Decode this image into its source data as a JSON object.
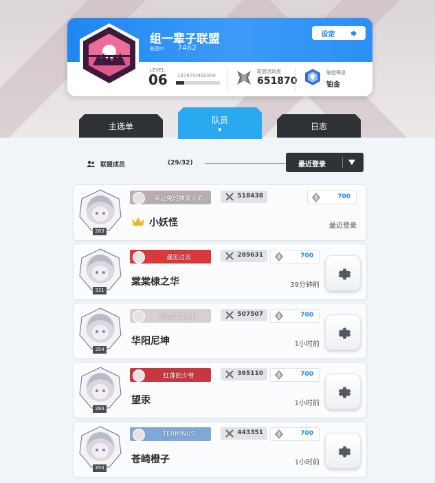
{
  "alliance": {
    "name": "组一辈子联盟",
    "id_label": "联盟ID",
    "id": "7462",
    "settings_label": "设定",
    "level_label": "LEVEL",
    "level": "06",
    "exp_text": "167870/900000",
    "exp_fraction": 0.19,
    "activity_label": "联盟活跃度",
    "activity": "651870",
    "rank_label": "联盟等级",
    "rank": "铂金"
  },
  "tabs": [
    {
      "label": "主选单"
    },
    {
      "label": "队员"
    },
    {
      "label": "日志"
    }
  ],
  "members_bar": {
    "label": "联盟成员",
    "count": "(29/32)",
    "sort_label": "最近登录"
  },
  "members": [
    {
      "title": "幸运兔的独家头彩",
      "power": "518438",
      "crystals": "700",
      "name": "小妖怪",
      "status": "最近登录",
      "level": "263",
      "leader": true,
      "plate_color": "#b9aeb2"
    },
    {
      "title": "遇见过去",
      "power": "289631",
      "crystals": "700",
      "name": "棠棠棣之华",
      "status": "39分钟前",
      "level": "331",
      "leader": false,
      "plate_color": "#d9393d"
    },
    {
      "title": "布兰儿的店长",
      "power": "507507",
      "crystals": "700",
      "name": "华阳尼坤",
      "status": "1小时前",
      "level": "354",
      "leader": false,
      "plate_color": "#d8cfd0"
    },
    {
      "title": "红莲的少爷",
      "power": "365110",
      "crystals": "700",
      "name": "望汞",
      "status": "1小时前",
      "level": "284",
      "leader": false,
      "plate_color": "#c8373d"
    },
    {
      "title": "TERMINUS",
      "power": "443351",
      "crystals": "700",
      "name": "苍崎橙子",
      "status": "1小时前",
      "level": "354",
      "leader": false,
      "plate_color": "#7fa7d8"
    }
  ],
  "colors": {
    "header_blue": "#1f86f2",
    "active_tab": "#2aa8f0",
    "inactive_tab": "#2e3136",
    "emblem_outer": "#3d1a3b",
    "emblem_inner": "#e05a8e",
    "crystal_text": "#1f86f2"
  },
  "icons": [
    "gear-icon",
    "crossed-swords-icon",
    "crystal-gem-icon",
    "crown-icon",
    "members-icon",
    "dropdown-triangle-icon",
    "shield-icon",
    "hex-badge-icon"
  ]
}
